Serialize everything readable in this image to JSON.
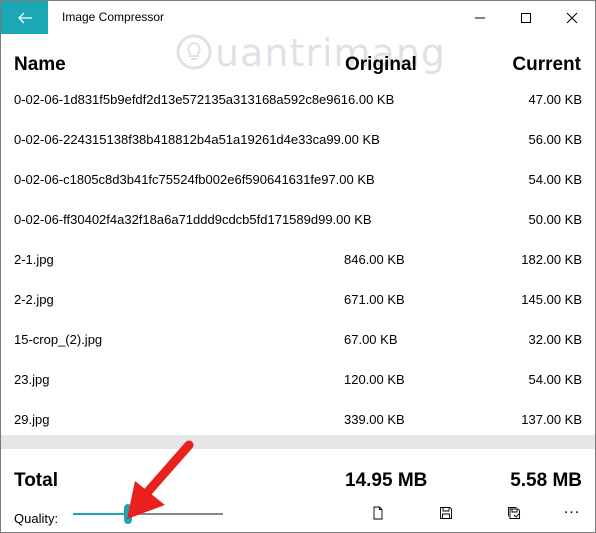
{
  "app": {
    "title": "Image Compressor",
    "accent_color": "#1ba8b5"
  },
  "titlebar": {
    "back_icon": "back-arrow-icon",
    "minimize_icon": "minimize-icon",
    "maximize_icon": "maximize-icon",
    "close_icon": "close-icon"
  },
  "watermark": {
    "text": "uantrimang",
    "icon": "lightbulb-logo-icon"
  },
  "columns": {
    "name": "Name",
    "original": "Original",
    "current": "Current"
  },
  "files": [
    {
      "name": "0-02-06-1d831f5b9efdf2d13e572135a313168a592c8e96",
      "original": "1",
      "original_tail": "6.00 KB",
      "current": "47.00 KB"
    },
    {
      "name": "0-02-06-224315138f38b418812b4a51a19261d4e33ca",
      "original_tail": "99.00 KB",
      "current": "56.00 KB"
    },
    {
      "name": "0-02-06-c1805c8d3b41fc75524fb002e6f590641631fe",
      "original_tail": "97.00 KB",
      "current": "54.00 KB"
    },
    {
      "name": "0-02-06-ff30402f4a32f18a6a71ddd9cdcb5fd171589d",
      "original_tail": "99.00 KB",
      "current": "50.00 KB"
    },
    {
      "name": "2-1.jpg",
      "original": "846.00 KB",
      "current": "182.00 KB"
    },
    {
      "name": "2-2.jpg",
      "original": "671.00 KB",
      "current": "145.00 KB"
    },
    {
      "name": "15-crop_(2).jpg",
      "original": "67.00 KB",
      "current": "32.00 KB"
    },
    {
      "name": "23.jpg",
      "original": "120.00 KB",
      "current": "54.00 KB"
    },
    {
      "name": "29.jpg",
      "original": "339.00 KB",
      "current": "137.00 KB"
    }
  ],
  "footer": {
    "total_label": "Total",
    "total_original": "14.95 MB",
    "total_current": "5.58 MB",
    "quality_label": "Quality:",
    "quality_fraction": 0.36,
    "new_icon": "new-file-icon",
    "save_icon": "save-icon",
    "save_all_icon": "save-all-icon",
    "more_label": "..."
  },
  "annotation": {
    "color": "#e8211c",
    "icon": "red-arrow-icon"
  }
}
